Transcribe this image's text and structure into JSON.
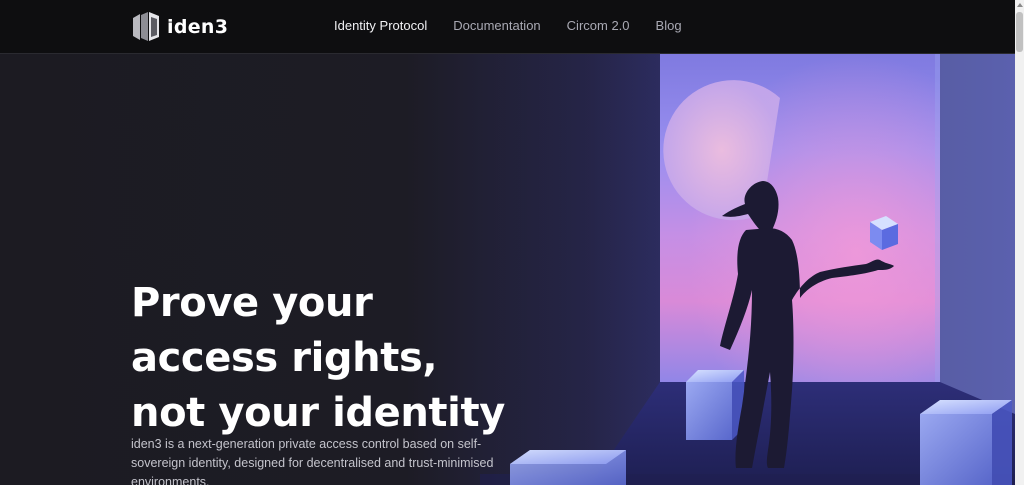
{
  "header": {
    "logo_text": "iden3",
    "nav": [
      {
        "label": "Identity Protocol",
        "active": true
      },
      {
        "label": "Documentation",
        "active": false
      },
      {
        "label": "Circom 2.0",
        "active": false
      },
      {
        "label": "Blog",
        "active": false
      }
    ]
  },
  "hero": {
    "headline_lines": [
      "Prove your",
      "access rights,",
      "not your identity"
    ],
    "description": "iden3 is a next-generation private access control based on self-sovereign identity, designed for decentralised and trust-minimised environments."
  },
  "colors": {
    "nav_bg": "#0e0e10",
    "hero_bg": "#1c1b22",
    "text_primary": "#ffffff",
    "nav_inactive": "#a9a9b3",
    "illustration_violet": "#8a78e6",
    "illustration_pink": "#d98ad8"
  }
}
